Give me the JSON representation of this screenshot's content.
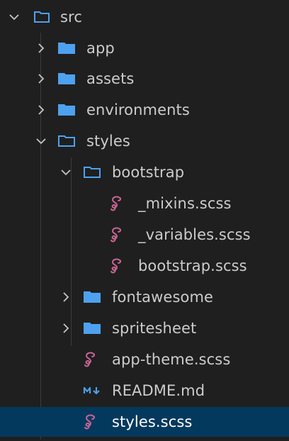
{
  "explorer": {
    "items": [
      {
        "label": "src",
        "kind": "folder",
        "state": "expanded",
        "icon": "folder-outline-icon"
      },
      {
        "label": "app",
        "kind": "folder",
        "state": "collapsed",
        "icon": "folder-icon"
      },
      {
        "label": "assets",
        "kind": "folder",
        "state": "collapsed",
        "icon": "folder-icon"
      },
      {
        "label": "environments",
        "kind": "folder",
        "state": "collapsed",
        "icon": "folder-icon"
      },
      {
        "label": "styles",
        "kind": "folder",
        "state": "expanded",
        "icon": "folder-outline-icon"
      },
      {
        "label": "bootstrap",
        "kind": "folder",
        "state": "expanded",
        "icon": "folder-outline-icon"
      },
      {
        "label": "_mixins.scss",
        "kind": "file",
        "icon": "sass-icon"
      },
      {
        "label": "_variables.scss",
        "kind": "file",
        "icon": "sass-icon"
      },
      {
        "label": "bootstrap.scss",
        "kind": "file",
        "icon": "sass-icon"
      },
      {
        "label": "fontawesome",
        "kind": "folder",
        "state": "collapsed",
        "icon": "folder-icon"
      },
      {
        "label": "spritesheet",
        "kind": "folder",
        "state": "collapsed",
        "icon": "folder-icon"
      },
      {
        "label": "app-theme.scss",
        "kind": "file",
        "icon": "sass-icon"
      },
      {
        "label": "README.md",
        "kind": "file",
        "icon": "markdown-icon",
        "badge": "M↓"
      },
      {
        "label": "styles.scss",
        "kind": "file",
        "icon": "sass-icon",
        "selected": true
      }
    ]
  },
  "colors": {
    "folder": "#4ea1f0",
    "sass": "#c76494",
    "markdown": "#4a9fe8",
    "selection": "#04395e",
    "text": "#cccccc",
    "chevron": "#c5c5c5"
  }
}
